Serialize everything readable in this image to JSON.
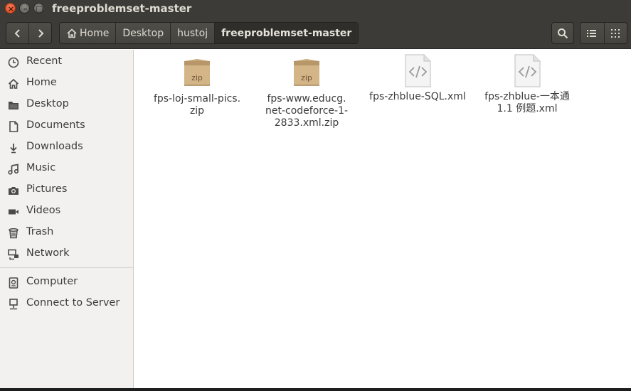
{
  "window": {
    "title": "freeproblemset-master",
    "close_glyph": "×",
    "minimize_glyph": "–",
    "maximize_glyph": "□"
  },
  "toolbar": {
    "back_icon": "chevron-left-icon",
    "forward_icon": "chevron-right-icon",
    "breadcrumbs": [
      "Home",
      "Desktop",
      "hustoj",
      "freeproblemset-master"
    ],
    "search_icon": "search-icon",
    "list_view_icon": "list-view-icon",
    "grid_view_icon": "grid-view-icon"
  },
  "sidebar": {
    "items": [
      {
        "label": "Recent",
        "icon": "clock-icon"
      },
      {
        "label": "Home",
        "icon": "home-icon"
      },
      {
        "label": "Desktop",
        "icon": "folder-icon"
      },
      {
        "label": "Documents",
        "icon": "document-icon"
      },
      {
        "label": "Downloads",
        "icon": "download-icon"
      },
      {
        "label": "Music",
        "icon": "music-icon"
      },
      {
        "label": "Pictures",
        "icon": "camera-icon"
      },
      {
        "label": "Videos",
        "icon": "video-icon"
      },
      {
        "label": "Trash",
        "icon": "trash-icon"
      },
      {
        "label": "Network",
        "icon": "network-icon"
      },
      {
        "label": "Computer",
        "icon": "computer-icon"
      },
      {
        "label": "Connect to Server",
        "icon": "server-icon"
      }
    ]
  },
  "files": [
    {
      "name": "fps-loj-small-pics.\nzip",
      "type": "zip",
      "badge": "zip"
    },
    {
      "name": "fps-www.educg.\nnet-codeforce-1-\n2833.xml.zip",
      "type": "zip",
      "badge": "zip"
    },
    {
      "name": "fps-zhblue-SQL.xml",
      "type": "xml"
    },
    {
      "name": "fps-zhblue-一本通\n1.1 例题.xml",
      "type": "xml"
    }
  ],
  "colors": {
    "titlebar": "#3c3b37",
    "close_button": "#df4a16",
    "sidebar": "#f2f1f0",
    "zip_box": "#c6a87a"
  }
}
